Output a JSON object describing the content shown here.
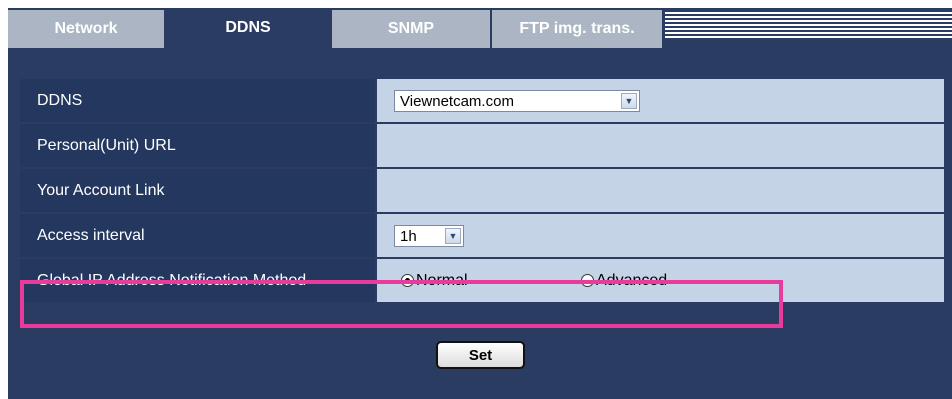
{
  "tabs": [
    "Network",
    "DDNS",
    "SNMP",
    "FTP img. trans."
  ],
  "active_tab": "DDNS",
  "rows": {
    "ddns": {
      "label": "DDNS",
      "value": "Viewnetcam.com"
    },
    "personal_url": {
      "label": "Personal(Unit) URL"
    },
    "account_link": {
      "label": "Your Account Link"
    },
    "access_interval": {
      "label": "Access interval",
      "value": "1h"
    },
    "notification": {
      "label": "Global IP Address Notification Method",
      "options": [
        "Normal",
        "Advanced"
      ],
      "selected": "Normal"
    }
  },
  "set_label": "Set",
  "colors": {
    "panel": "#2b3c63",
    "label_bg": "#24375e",
    "value_bg": "#c5d3e6",
    "highlight": "#e93b9c"
  }
}
